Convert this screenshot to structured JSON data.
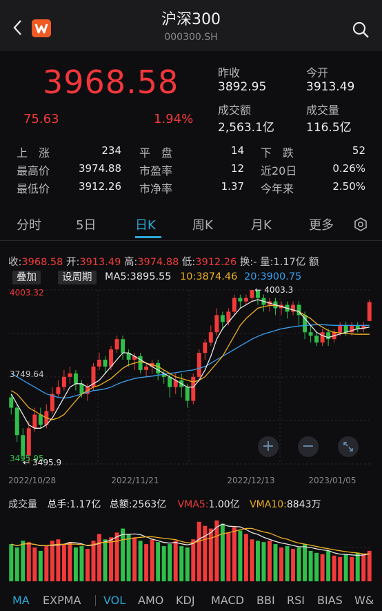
{
  "header": {
    "title": "沪深300",
    "code": "000300.SH"
  },
  "quote": {
    "price": "3968.58",
    "change": "75.63",
    "change_pct": "1.94%",
    "prev_close_label": "昨收",
    "prev_close": "3892.95",
    "open_label": "今开",
    "open": "3913.49",
    "turnover_label": "成交额",
    "turnover": "2,563.1亿",
    "volume_label": "成交量",
    "volume": "116.5亿"
  },
  "stats": [
    {
      "label": "上　涨",
      "value": "234"
    },
    {
      "label": "平　盘",
      "value": "14"
    },
    {
      "label": "下　跌",
      "value": "52"
    },
    {
      "label": "最高价",
      "value": "3974.88"
    },
    {
      "label": "市盈率",
      "value": "12"
    },
    {
      "label": "近20日",
      "value": "0.26%"
    },
    {
      "label": "最低价",
      "value": "3912.26"
    },
    {
      "label": "市净率",
      "value": "1.37"
    },
    {
      "label": "今年来",
      "value": "2.50%"
    }
  ],
  "tabs": [
    "分时",
    "5日",
    "日K",
    "周K",
    "月K",
    "更多"
  ],
  "active_tab": "日K",
  "ohlc": {
    "close_label": "收:",
    "close": "3968.58",
    "open_label": "开:",
    "open": "3913.49",
    "high_label": "高:",
    "high": "3974.88",
    "low_label": "低:",
    "low": "3912.26",
    "turnover_label": "换:",
    "turnover": "-",
    "volume_label": "量:",
    "volume": "1.17亿",
    "amount_label": "额"
  },
  "ma": {
    "overlay_btn": "叠加",
    "period_btn": "设周期",
    "ma5_label": "MA5:",
    "ma5": "3895.55",
    "ma10_label": "10:",
    "ma10": "3874.46",
    "ma20_label": "20:",
    "ma20": "3900.75"
  },
  "colors": {
    "up": "#f23a3a",
    "down": "#2fbf4a",
    "ma5": "#e8e8e8",
    "ma10": "#f0b020",
    "ma20": "#3aa0f0",
    "accent": "#2aa8d8"
  },
  "chart_data": {
    "type": "candlestick",
    "y_labels": {
      "top": "4003.32",
      "mid": "3749.64",
      "bottom": "3495.95"
    },
    "annotations": {
      "high": "4003.3",
      "low": "3495.9"
    },
    "x_ticks": [
      "2022/10/28",
      "2022/11/21",
      "2022/12/13",
      "2023/01/05"
    ],
    "ylim": [
      3495.95,
      4003.32
    ],
    "candles": [
      [
        3690,
        3660,
        3700,
        3640
      ],
      [
        3660,
        3580,
        3670,
        3560
      ],
      [
        3580,
        3520,
        3600,
        3500
      ],
      [
        3520,
        3600,
        3620,
        3500
      ],
      [
        3600,
        3640,
        3660,
        3590
      ],
      [
        3640,
        3610,
        3660,
        3600
      ],
      [
        3610,
        3650,
        3670,
        3600
      ],
      [
        3650,
        3700,
        3720,
        3640
      ],
      [
        3700,
        3720,
        3740,
        3690
      ],
      [
        3720,
        3750,
        3770,
        3710
      ],
      [
        3750,
        3760,
        3780,
        3730
      ],
      [
        3760,
        3730,
        3770,
        3710
      ],
      [
        3730,
        3700,
        3740,
        3690
      ],
      [
        3700,
        3720,
        3730,
        3680
      ],
      [
        3720,
        3780,
        3790,
        3710
      ],
      [
        3780,
        3800,
        3820,
        3770
      ],
      [
        3800,
        3780,
        3810,
        3760
      ],
      [
        3780,
        3830,
        3840,
        3770
      ],
      [
        3830,
        3860,
        3870,
        3820
      ],
      [
        3860,
        3820,
        3870,
        3800
      ],
      [
        3820,
        3800,
        3830,
        3780
      ],
      [
        3800,
        3810,
        3820,
        3770
      ],
      [
        3810,
        3770,
        3820,
        3760
      ],
      [
        3770,
        3780,
        3790,
        3750
      ],
      [
        3780,
        3790,
        3800,
        3760
      ],
      [
        3790,
        3760,
        3800,
        3740
      ],
      [
        3760,
        3750,
        3770,
        3730
      ],
      [
        3750,
        3720,
        3760,
        3690
      ],
      [
        3720,
        3740,
        3760,
        3700
      ],
      [
        3740,
        3720,
        3760,
        3690
      ],
      [
        3720,
        3680,
        3730,
        3660
      ],
      [
        3680,
        3750,
        3760,
        3670
      ],
      [
        3750,
        3820,
        3830,
        3740
      ],
      [
        3820,
        3850,
        3860,
        3800
      ],
      [
        3850,
        3880,
        3900,
        3840
      ],
      [
        3880,
        3930,
        3950,
        3870
      ],
      [
        3930,
        3910,
        3940,
        3890
      ],
      [
        3910,
        3940,
        3950,
        3900
      ],
      [
        3940,
        3980,
        3990,
        3930
      ],
      [
        3980,
        3970,
        3990,
        3950
      ],
      [
        3970,
        3980,
        3990,
        3960
      ],
      [
        3980,
        4003,
        4003,
        3970
      ],
      [
        4003,
        3980,
        4003,
        3960
      ],
      [
        3980,
        3960,
        3990,
        3940
      ],
      [
        3960,
        3970,
        3980,
        3940
      ],
      [
        3970,
        3950,
        3980,
        3930
      ],
      [
        3950,
        3960,
        3970,
        3930
      ],
      [
        3960,
        3940,
        3970,
        3920
      ],
      [
        3940,
        3960,
        3970,
        3930
      ],
      [
        3960,
        3930,
        3970,
        3900
      ],
      [
        3930,
        3880,
        3940,
        3860
      ],
      [
        3880,
        3870,
        3900,
        3850
      ],
      [
        3870,
        3850,
        3880,
        3840
      ],
      [
        3850,
        3880,
        3890,
        3840
      ],
      [
        3880,
        3860,
        3890,
        3840
      ],
      [
        3860,
        3880,
        3890,
        3850
      ],
      [
        3880,
        3900,
        3910,
        3870
      ],
      [
        3900,
        3880,
        3910,
        3870
      ],
      [
        3880,
        3900,
        3910,
        3870
      ],
      [
        3900,
        3890,
        3910,
        3880
      ],
      [
        3890,
        3900,
        3910,
        3880
      ],
      [
        3913,
        3968,
        3975,
        3912
      ]
    ],
    "ma5": [
      3700,
      3670,
      3640,
      3610,
      3600,
      3600,
      3610,
      3630,
      3660,
      3690,
      3720,
      3730,
      3730,
      3720,
      3730,
      3740,
      3760,
      3780,
      3800,
      3820,
      3820,
      3810,
      3800,
      3790,
      3780,
      3770,
      3760,
      3750,
      3740,
      3730,
      3720,
      3720,
      3740,
      3770,
      3810,
      3860,
      3890,
      3910,
      3930,
      3950,
      3960,
      3970,
      3975,
      3970,
      3965,
      3960,
      3955,
      3950,
      3945,
      3940,
      3920,
      3900,
      3880,
      3870,
      3865,
      3870,
      3875,
      3880,
      3885,
      3890,
      3892,
      3895
    ],
    "ma10": [
      3710,
      3700,
      3680,
      3660,
      3650,
      3640,
      3630,
      3625,
      3630,
      3640,
      3660,
      3680,
      3700,
      3710,
      3720,
      3725,
      3735,
      3745,
      3760,
      3775,
      3785,
      3790,
      3795,
      3790,
      3785,
      3780,
      3770,
      3760,
      3750,
      3745,
      3740,
      3735,
      3740,
      3750,
      3770,
      3790,
      3810,
      3840,
      3870,
      3900,
      3920,
      3935,
      3950,
      3955,
      3958,
      3958,
      3955,
      3950,
      3945,
      3940,
      3930,
      3920,
      3905,
      3895,
      3885,
      3880,
      3878,
      3876,
      3875,
      3874,
      3874,
      3874
    ],
    "ma20": [
      3760,
      3750,
      3740,
      3730,
      3720,
      3710,
      3700,
      3695,
      3690,
      3688,
      3690,
      3695,
      3700,
      3705,
      3710,
      3712,
      3715,
      3720,
      3728,
      3735,
      3740,
      3745,
      3748,
      3750,
      3752,
      3755,
      3757,
      3760,
      3762,
      3765,
      3768,
      3770,
      3775,
      3780,
      3790,
      3800,
      3810,
      3820,
      3830,
      3840,
      3850,
      3860,
      3868,
      3875,
      3880,
      3885,
      3890,
      3893,
      3896,
      3898,
      3900,
      3901,
      3902,
      3902,
      3901,
      3900,
      3900,
      3900,
      3900,
      3900,
      3900,
      3900
    ]
  },
  "volume": {
    "label": "成交量",
    "total_hands_label": "总手:",
    "total_hands": "1.17亿",
    "total_amount_label": "总额:",
    "total_amount": "2563亿",
    "vma5_label": "VMA5:",
    "vma5": "1.00亿",
    "vma10_label": "VMA10:",
    "vma10": "8843万",
    "bars": [
      0.55,
      0.5,
      0.6,
      0.58,
      0.5,
      0.45,
      0.52,
      0.6,
      0.62,
      0.55,
      0.58,
      0.5,
      0.52,
      0.48,
      0.6,
      0.7,
      0.62,
      0.65,
      0.72,
      0.78,
      0.7,
      0.65,
      0.6,
      0.55,
      0.62,
      0.58,
      0.52,
      0.55,
      0.6,
      0.52,
      0.5,
      0.62,
      0.88,
      0.82,
      0.78,
      0.9,
      0.85,
      0.72,
      0.8,
      0.75,
      0.7,
      0.62,
      0.6,
      0.58,
      0.6,
      0.55,
      0.5,
      0.52,
      0.48,
      0.5,
      0.55,
      0.45,
      0.42,
      0.4,
      0.45,
      0.38,
      0.36,
      0.4,
      0.36,
      0.42,
      0.4,
      0.45
    ]
  },
  "indicators": [
    "MA",
    "EXPMA",
    "VOL",
    "AMO",
    "KDJ",
    "MACD",
    "BBI",
    "RSI",
    "BIAS",
    "W&"
  ]
}
